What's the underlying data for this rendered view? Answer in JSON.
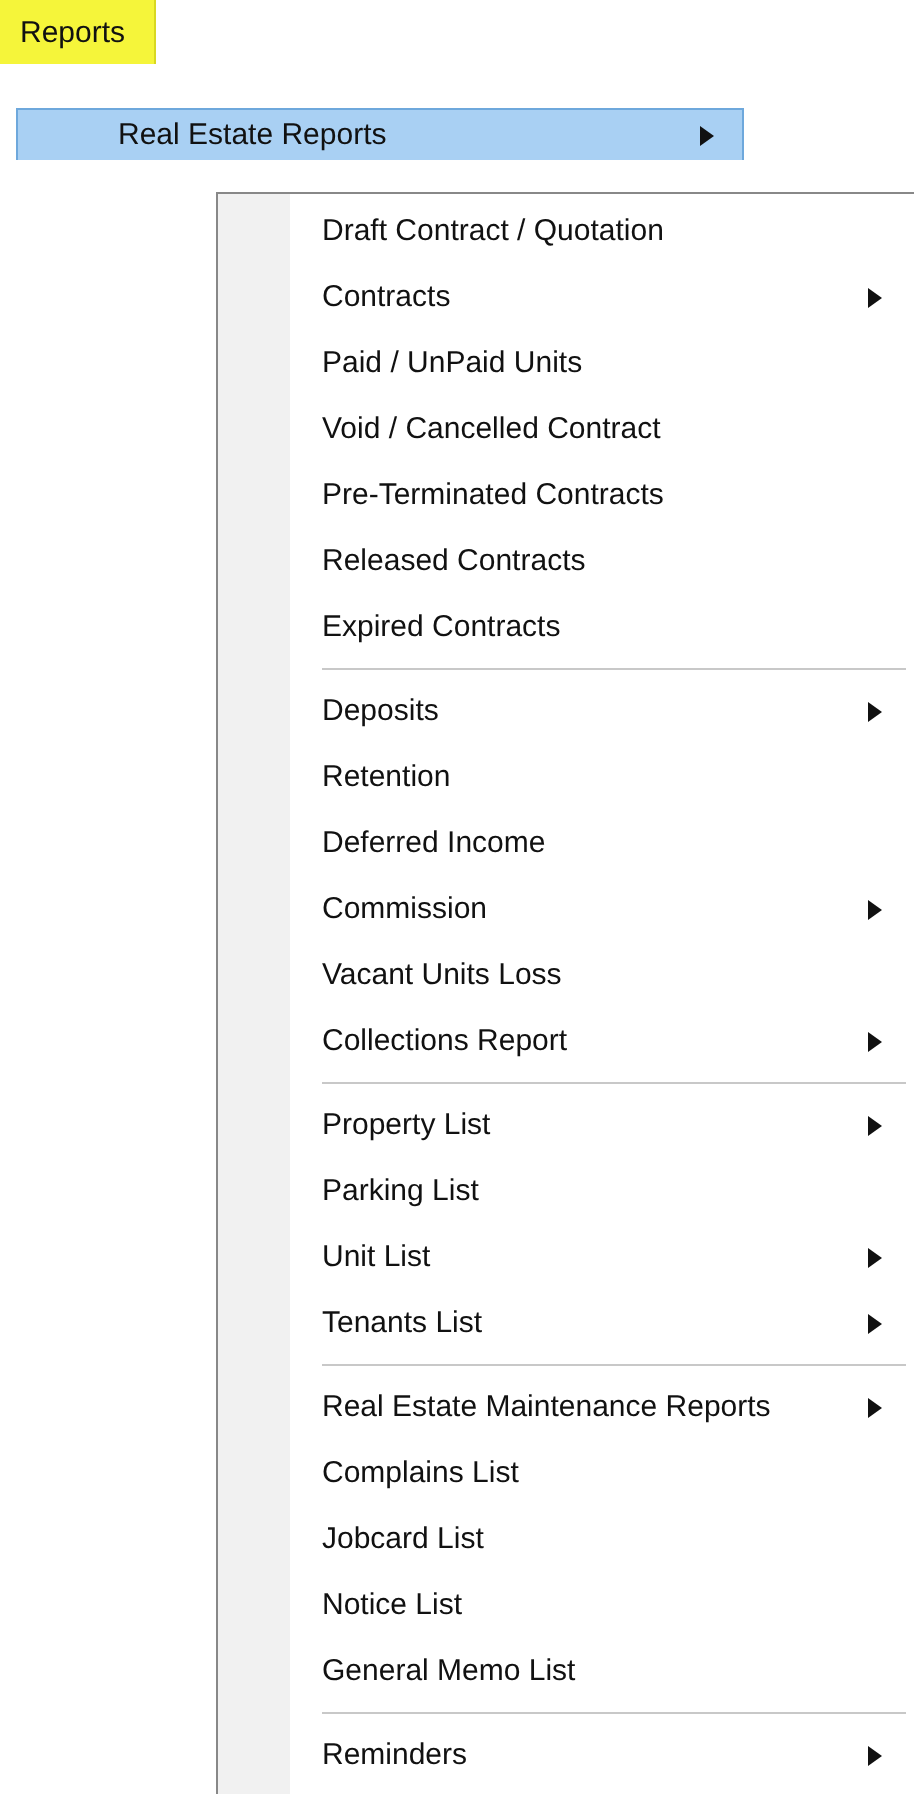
{
  "menu_bar": {
    "label": "Reports",
    "highlighted": true
  },
  "parent_item": {
    "label": "Real Estate Reports",
    "selected": true,
    "submenu": true
  },
  "submenu": {
    "groups": [
      {
        "items": [
          {
            "label": "Draft Contract / Quotation",
            "submenu": false
          },
          {
            "label": "Contracts",
            "submenu": true
          },
          {
            "label": "Paid / UnPaid Units",
            "submenu": false
          },
          {
            "label": "Void / Cancelled Contract",
            "submenu": false
          },
          {
            "label": "Pre-Terminated Contracts",
            "submenu": false
          },
          {
            "label": "Released Contracts",
            "submenu": false
          },
          {
            "label": "Expired Contracts",
            "submenu": false
          }
        ]
      },
      {
        "items": [
          {
            "label": "Deposits",
            "submenu": true
          },
          {
            "label": "Retention",
            "submenu": false
          },
          {
            "label": "Deferred Income",
            "submenu": false
          },
          {
            "label": "Commission",
            "submenu": true
          },
          {
            "label": "Vacant Units Loss",
            "submenu": false
          },
          {
            "label": "Collections Report",
            "submenu": true
          }
        ]
      },
      {
        "items": [
          {
            "label": "Property List",
            "submenu": true
          },
          {
            "label": "Parking List",
            "submenu": false
          },
          {
            "label": "Unit List",
            "submenu": true
          },
          {
            "label": "Tenants List",
            "submenu": true
          }
        ]
      },
      {
        "items": [
          {
            "label": "Real Estate Maintenance Reports",
            "submenu": true
          },
          {
            "label": "Complains List",
            "submenu": false
          },
          {
            "label": "Jobcard List",
            "submenu": false
          },
          {
            "label": "Notice List",
            "submenu": false
          },
          {
            "label": "General Memo List",
            "submenu": false
          }
        ]
      },
      {
        "items": [
          {
            "label": "Reminders",
            "submenu": true
          }
        ]
      }
    ]
  }
}
